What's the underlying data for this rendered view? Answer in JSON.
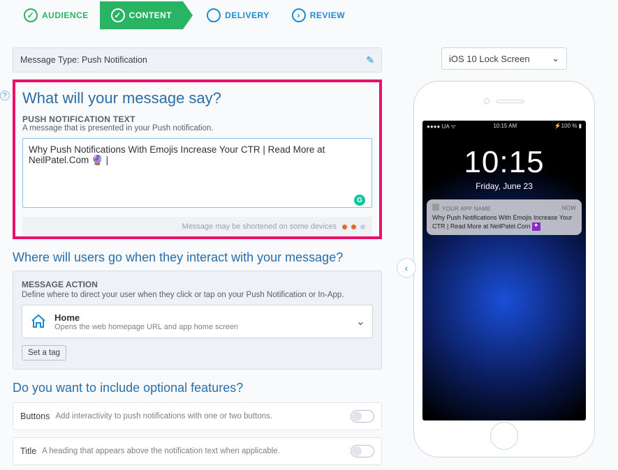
{
  "stepper": {
    "audience": "AUDIENCE",
    "content": "CONTENT",
    "delivery": "DELIVERY",
    "review": "REVIEW"
  },
  "message_type_row": "Message Type: Push Notification",
  "section1": {
    "heading": "What will your message say?",
    "label": "PUSH NOTIFICATION TEXT",
    "sub": "A message that is presented in your Push notification.",
    "text_value": "Why Push Notifications With Emojis Increase Your CTR | Read More at NeilPatel.Com 🔮 |",
    "warn": "Message may be shortened on some devices"
  },
  "section2": {
    "heading": "Where will users go when they interact with your message?",
    "label": "MESSAGE ACTION",
    "sub": "Define where to direct your user when they click or tap on your Push Notification or In-App.",
    "dd_title": "Home",
    "dd_sub": "Opens the web homepage URL and app home screen",
    "set_tag": "Set a tag"
  },
  "section3": {
    "heading": "Do you want to include optional features?",
    "buttons_t": "Buttons",
    "buttons_d": "Add interactivity to push notifications with one or two buttons.",
    "title_t": "Title",
    "title_d": "A heading that appears above the notification text when applicable."
  },
  "preview": {
    "select": "iOS 10 Lock Screen",
    "status_left": "●●●● UA ᯤ",
    "status_mid": "10:15 AM",
    "status_right": "⚡100 % ▮",
    "time": "10:15",
    "date": "Friday, June 23",
    "app_name": "YOUR APP NAME",
    "now": "now",
    "notif_text": "Why Push Notifications With Emojis Increase Your CTR | Read More at NeilPatel.Com"
  }
}
